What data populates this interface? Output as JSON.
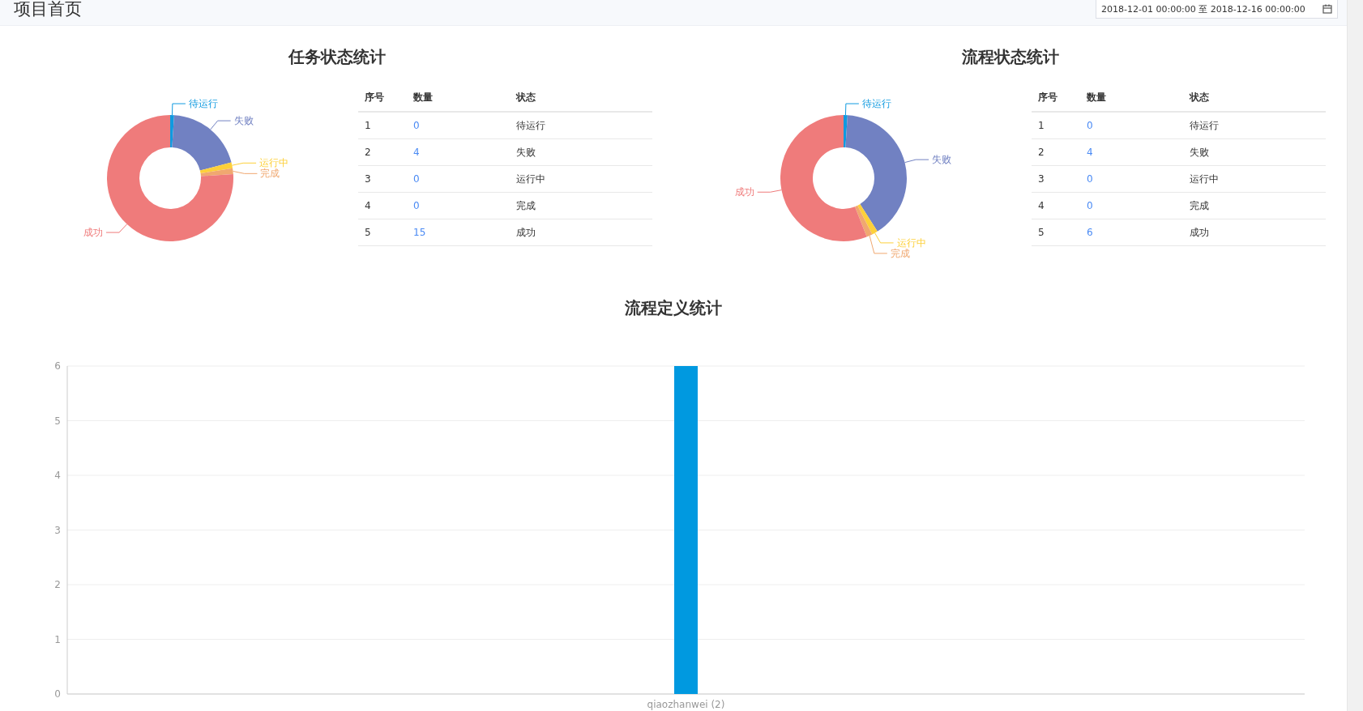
{
  "header": {
    "title": "项目首页",
    "date_range": {
      "value": "2018-12-01 00:00:00 至 2018-12-16 00:00:00"
    }
  },
  "panels": [
    {
      "title": "任务状态统计",
      "chart_data": {
        "type": "donut",
        "categories": [
          "待运行",
          "失败",
          "运行中",
          "完成",
          "成功"
        ],
        "values": [
          1,
          20,
          1.5,
          1.5,
          76
        ],
        "colors": [
          "#0f9ae0",
          "#7181c2",
          "#fdd03a",
          "#f0a870",
          "#ef7b7b"
        ]
      },
      "table": {
        "columns": [
          "序号",
          "数量",
          "状态"
        ],
        "rows": [
          {
            "index": "1",
            "count": "0",
            "status": "待运行"
          },
          {
            "index": "2",
            "count": "4",
            "status": "失败"
          },
          {
            "index": "3",
            "count": "0",
            "status": "运行中"
          },
          {
            "index": "4",
            "count": "0",
            "status": "完成"
          },
          {
            "index": "5",
            "count": "15",
            "status": "成功"
          }
        ]
      }
    },
    {
      "title": "流程状态统计",
      "chart_data": {
        "type": "donut",
        "categories": [
          "待运行",
          "失败",
          "运行中",
          "完成",
          "成功"
        ],
        "values": [
          1,
          40,
          1.5,
          1.5,
          56
        ],
        "colors": [
          "#0f9ae0",
          "#7181c2",
          "#fdd03a",
          "#f0a870",
          "#ef7b7b"
        ]
      },
      "table": {
        "columns": [
          "序号",
          "数量",
          "状态"
        ],
        "rows": [
          {
            "index": "1",
            "count": "0",
            "status": "待运行"
          },
          {
            "index": "2",
            "count": "4",
            "status": "失败"
          },
          {
            "index": "3",
            "count": "0",
            "status": "运行中"
          },
          {
            "index": "4",
            "count": "0",
            "status": "完成"
          },
          {
            "index": "5",
            "count": "6",
            "status": "成功"
          }
        ]
      }
    }
  ],
  "definition_chart": {
    "title": "流程定义统计",
    "chart_data": {
      "type": "bar",
      "categories": [
        "qiaozhanwei (2)"
      ],
      "values": [
        6
      ],
      "grid": true,
      "ylim": [
        0,
        6
      ],
      "yticks": [
        0,
        1,
        2,
        3,
        4,
        5,
        6
      ]
    }
  }
}
